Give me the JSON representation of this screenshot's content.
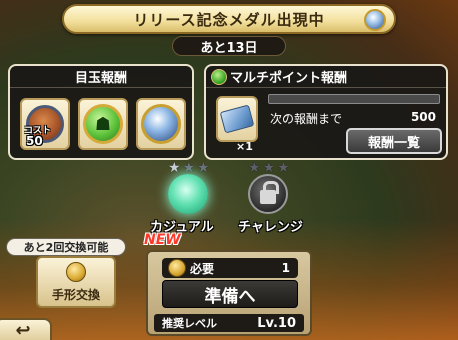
{
  "banner": {
    "title": "リリース記念メダル出現中",
    "medal_icon": "medal-icon"
  },
  "timer": {
    "text": "あと13日"
  },
  "featured": {
    "title": "目玉報酬",
    "cost_label": "コスト",
    "cost_value": "50",
    "items": [
      {
        "icon": "bear-coin-icon"
      },
      {
        "icon": "multi-player-coin-icon"
      },
      {
        "icon": "blue-medal-icon"
      }
    ]
  },
  "multi_points": {
    "title": "マルチポイント報酬",
    "icon": "multi-player-icon",
    "ticket_icon": "ticket-icon",
    "ticket_count": "×1",
    "progress": 0,
    "next_label": "次の報酬まで",
    "next_value": "500",
    "list_button": "報酬一覧"
  },
  "difficulty": {
    "casual": {
      "label": "カジュアル",
      "stars_lit": 1,
      "stars_total": 3,
      "badge": "NEW"
    },
    "challenge": {
      "label": "チャレンジ",
      "stars_lit": 0,
      "stars_total": 3,
      "locked": true
    }
  },
  "exchange": {
    "remaining": "あと2回交換可能",
    "button": "手形交換"
  },
  "prepare": {
    "required_label": "必要",
    "required_value": "1",
    "button": "準備へ",
    "level_label": "推奨レベル",
    "level_value": "Lv.10"
  },
  "back": {
    "icon": "back-arrow-icon"
  }
}
